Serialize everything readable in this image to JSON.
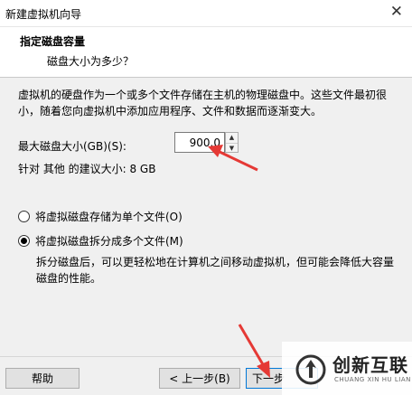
{
  "window": {
    "title": "新建虚拟机向导",
    "close_glyph": "✕"
  },
  "header": {
    "title": "指定磁盘容量",
    "subtitle": "磁盘大小为多少？"
  },
  "description": "虚拟机的硬盘作为一个或多个文件存储在主机的物理磁盘中。这些文件最初很小，随着您向虚拟机中添加应用程序、文件和数据而逐渐变大。",
  "disk_size": {
    "label": "最大磁盘大小(GB)(S):",
    "value": "900.0"
  },
  "recommended": "针对 其他 的建议大小: 8 GB",
  "options": [
    {
      "label": "将虚拟磁盘存储为单个文件(O)",
      "selected": false
    },
    {
      "label": "将虚拟磁盘拆分成多个文件(M)",
      "selected": true
    }
  ],
  "split_description": "拆分磁盘后，可以更轻松地在计算机之间移动虚拟机，但可能会降低大容量磁盘的性能。",
  "buttons": {
    "help": "帮助",
    "back": "< 上一步(B)",
    "next": "下一步"
  },
  "watermark": {
    "text": "创新互联",
    "subtext": "CHUANG XIN HU LIAN"
  },
  "colors": {
    "arrow": "#e53935",
    "accent": "#0078d7"
  }
}
